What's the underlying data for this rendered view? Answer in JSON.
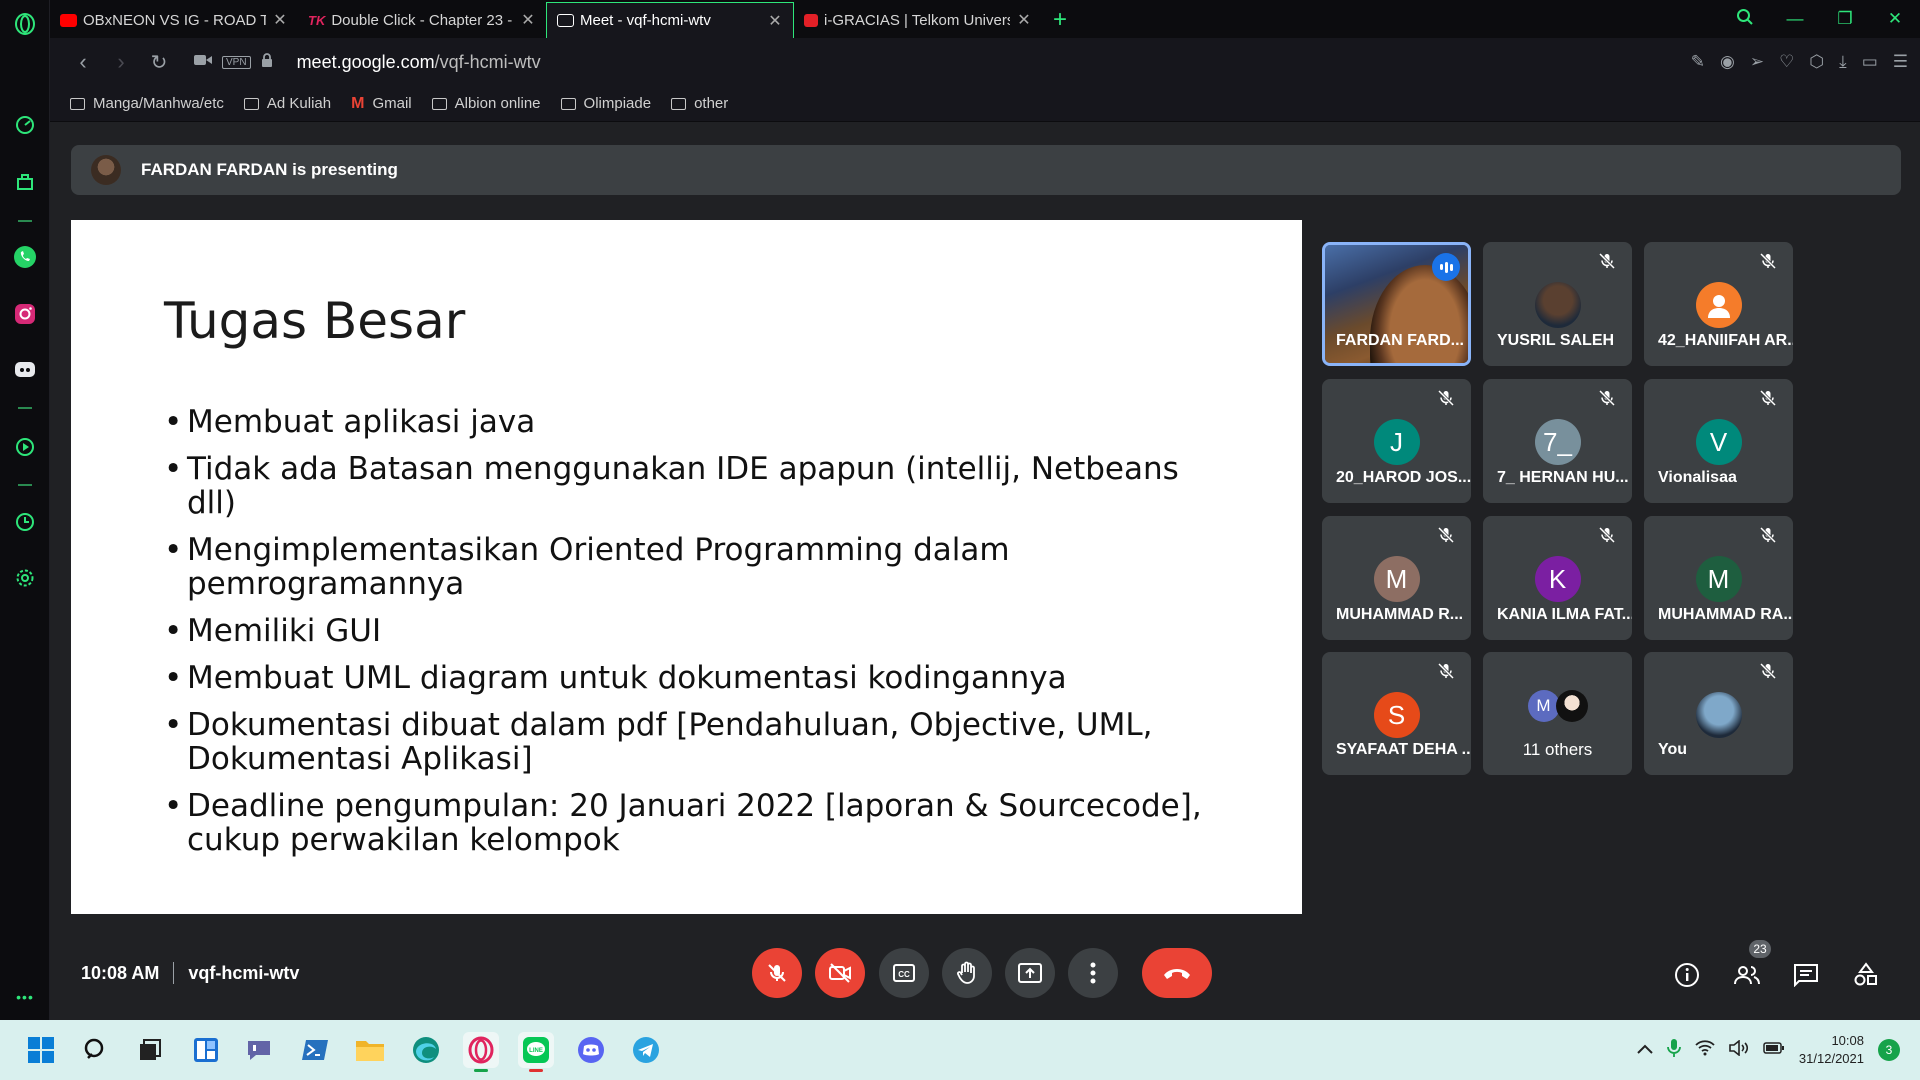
{
  "browser": {
    "tabs": [
      {
        "title": "OBxNEON VS IG - ROAD TO",
        "favicon": "youtube-icon",
        "color": "#ff0000",
        "active": false
      },
      {
        "title": "Double Click - Chapter 23 -",
        "favicon": "toonily-icon",
        "color": "#e0245e",
        "active": false
      },
      {
        "title": "Meet - vqf-hcmi-wtv",
        "favicon": "meet-icon",
        "color": "#ffffff",
        "active": true
      },
      {
        "title": "i-GRACIAS | Telkom Univers",
        "favicon": "igracias-icon",
        "color": "#e32027",
        "active": false
      }
    ],
    "url_host": "meet.google.com",
    "url_path": "/vqf-hcmi-wtv",
    "vpn_label": "VPN",
    "bookmarks": [
      {
        "label": "Manga/Manhwa/etc",
        "icon": "folder-icon"
      },
      {
        "label": "Ad Kuliah",
        "icon": "folder-icon"
      },
      {
        "label": "Gmail",
        "icon": "gmail-icon"
      },
      {
        "label": "Albion online",
        "icon": "folder-icon"
      },
      {
        "label": "Olimpiade",
        "icon": "folder-icon"
      },
      {
        "label": "other",
        "icon": "folder-icon"
      }
    ],
    "accent_color": "#2ee67a"
  },
  "meet": {
    "presenting_text": "FARDAN FARDAN is presenting",
    "slide": {
      "title": "Tugas Besar",
      "bullets": [
        "Membuat aplikasi java",
        "Tidak ada Batasan menggunakan IDE apapun (intellij, Netbeans dll)",
        "Mengimplementasikan Oriented Programming dalam pemrogramannya",
        "Memiliki GUI",
        "Membuat UML diagram untuk dokumentasi kodingannya",
        "Dokumentasi dibuat dalam pdf [Pendahuluan, Objective, UML, Dokumentasi Aplikasi]",
        "Deadline pengumpulan: 20 Januari 2022 [laporan & Sourcecode], cukup perwakilan kelompok"
      ]
    },
    "participants": [
      {
        "name": "FARDAN FARD...",
        "type": "video",
        "speaking": true
      },
      {
        "name": "YUSRIL SALEH",
        "type": "photo",
        "initial": "",
        "color": "#5a4030",
        "muted": true
      },
      {
        "name": "42_HANIIFAH AR...",
        "type": "default",
        "initial": "",
        "color": "#f57c2a",
        "muted": true
      },
      {
        "name": "20_HAROD JOS...",
        "type": "initial",
        "initial": "J",
        "color": "#00897b",
        "muted": true
      },
      {
        "name": "7_ HERNAN HU...",
        "type": "initial",
        "initial": "7_",
        "color": "#78909c",
        "muted": true
      },
      {
        "name": "Vionalisaa",
        "type": "initial",
        "initial": "V",
        "color": "#00897b",
        "muted": true
      },
      {
        "name": "MUHAMMAD R...",
        "type": "initial",
        "initial": "M",
        "color": "#8d6e63",
        "muted": true
      },
      {
        "name": "KANIA ILMA FAT...",
        "type": "initial",
        "initial": "K",
        "color": "#7b1fa2",
        "muted": true
      },
      {
        "name": "MUHAMMAD RA...",
        "type": "initial",
        "initial": "M",
        "color": "#1e5e3f",
        "muted": true
      },
      {
        "name": "SYAFAAT DEHA ...",
        "type": "initial",
        "initial": "S",
        "color": "#e64a19",
        "muted": true
      },
      {
        "name": "11 others",
        "type": "others",
        "initial": "M",
        "color": "#5c6bc0",
        "muted": false
      },
      {
        "name": "You",
        "type": "photo",
        "initial": "",
        "color": "#7fa8c9",
        "muted": true
      }
    ],
    "time": "10:08 AM",
    "meeting_code": "vqf-hcmi-wtv",
    "people_count": "23"
  },
  "taskbar": {
    "apps": [
      "start",
      "search",
      "task-view",
      "widgets",
      "teams-chat",
      "powershell",
      "file-explorer",
      "edge",
      "opera-gx",
      "line",
      "discord",
      "telegram"
    ],
    "clock_time": "10:08",
    "clock_date": "31/12/2021",
    "notifications": "3"
  }
}
